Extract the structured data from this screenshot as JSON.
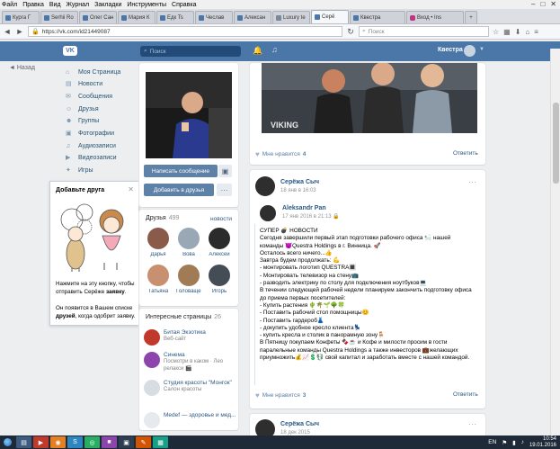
{
  "browser": {
    "menu": [
      "Файл",
      "Правка",
      "Вид",
      "Журнал",
      "Закладки",
      "Инструменты",
      "Справка"
    ],
    "tabs": [
      {
        "label": "Курга Г",
        "icon": "vk"
      },
      {
        "label": "Serhii Ro",
        "icon": "vk"
      },
      {
        "label": "Олег Сан",
        "icon": "vk"
      },
      {
        "label": "Мария К",
        "icon": "vk"
      },
      {
        "label": "Едк Ts",
        "icon": "vk"
      },
      {
        "label": "Чеслав",
        "icon": "vk"
      },
      {
        "label": "Алексан",
        "icon": "vk"
      },
      {
        "label": "Luxury te",
        "icon": "gen"
      },
      {
        "label": "Серё",
        "icon": "vk"
      },
      {
        "label": "Квестра",
        "icon": "vk"
      },
      {
        "label": "Вход • Ins",
        "icon": "ig"
      }
    ],
    "url": "https://vk.com/id21449087",
    "search_placeholder": "Поиск"
  },
  "vk_header": {
    "logo": "VK",
    "search_placeholder": "Поиск",
    "user_name": "Квестра"
  },
  "left_nav": {
    "back_label": "Назад",
    "items": [
      {
        "label": "Моя Страница",
        "icon": "home-icon",
        "glyph": "⌂"
      },
      {
        "label": "Новости",
        "icon": "news-icon",
        "glyph": "▤"
      },
      {
        "label": "Сообщения",
        "icon": "messages-icon",
        "glyph": "✉"
      },
      {
        "label": "Друзья",
        "icon": "friends-icon",
        "glyph": "☺"
      },
      {
        "label": "Группы",
        "icon": "groups-icon",
        "glyph": "☻"
      },
      {
        "label": "Фотографии",
        "icon": "photos-icon",
        "glyph": "▣"
      },
      {
        "label": "Аудиозаписи",
        "icon": "audio-icon",
        "glyph": "♫"
      },
      {
        "label": "Видеозаписи",
        "icon": "video-icon",
        "glyph": "▶"
      },
      {
        "label": "Игры",
        "icon": "games-icon",
        "glyph": "✦"
      }
    ]
  },
  "tooltip": {
    "title": "Добавьте друга",
    "p1_pre": "Нажмите на эту кнопку, чтобы отправить Серёже ",
    "p1_bold": "заявку",
    "p1_post": ".",
    "p2_pre": "Он появится в Вашем списке ",
    "p2_bold": "друзей",
    "p2_post": ", когда одобрит заявку."
  },
  "profile": {
    "send_message": "Написать сообщение",
    "add_friend": "Добавить в друзья",
    "more": "···"
  },
  "friends": {
    "title": "Друзья",
    "count": "499",
    "link": "новости",
    "items": [
      {
        "name": "Дарья",
        "color": "#8a5a4a"
      },
      {
        "name": "Вова",
        "color": "#9aa7b5"
      },
      {
        "name": "Алексей",
        "color": "#2b2b2b"
      },
      {
        "name": "Татьяна",
        "color": "#c88f70"
      },
      {
        "name": "Головаще...",
        "color": "#a07b55"
      },
      {
        "name": "Игорь",
        "color": "#444c55"
      }
    ]
  },
  "interesting": {
    "title": "Интересные страницы",
    "count": "26",
    "items": [
      {
        "name": "Битая Экзотика",
        "desc": "Веб-сайт",
        "color": "#c0392b"
      },
      {
        "name": "Синема",
        "desc": "Посмотри в каком · Лео релакси 🎬",
        "color": "#8e44ad"
      },
      {
        "name": "Студия красоты \"Монгок\"",
        "desc": "Салон красоты",
        "color": "#d8dde4"
      },
      {
        "name": "Medef — здоровье и мед...",
        "desc": "",
        "color": "#e6e9ed"
      }
    ]
  },
  "post1": {
    "likes_label": "Мне нравится",
    "likes": "4",
    "reply": "Ответить",
    "watermark": "VIKING"
  },
  "post2": {
    "author": "Серёжа Сыч",
    "date": "18 янв в 16:03",
    "repost_author": "Aleksandr Pan",
    "repost_date": "17 янв 2016 в 21:13 🔒",
    "text": [
      "СУПЕР 💣 НОВОСТИ",
      "Сегодня завершили первый этап подготовки рабочего офиса 🛀 нашей",
      "команды 😈Questra Holdings в г. Винница. 🚀",
      "Осталось всего ничего...👍",
      "Завтра будем продолжать: 💪",
      "- монтировать логотип QUESTRA🔳",
      "- Монтировать телевизор на стену📺",
      "- разводить электрику по столу для подключения ноутбуков💻",
      "В течении следующей рабочей недели планируем закончить подготовку офиса",
      "до приема первых посетителей:",
      "- Купить растения 🌵🌴🌱🌳🍀",
      "- Поставить рабочий стол помощницы😊",
      "- Поставить гардероб👗",
      "- докупить удобное кресло клиента💺",
      "- купить кресла и столик в панорамную зону🪑",
      "В Пятницу покупаем Конфеты 🍫☕ и Кофе и милости просим в гости",
      "паралельные команды Questra Holdings а также инвесторов 💼желающих",
      "приумножить💰📈💲💱 свой капитал и заработать вместе с нашей командой."
    ],
    "likes_label": "Мне нравится",
    "likes": "3",
    "reply": "Ответить"
  },
  "post3": {
    "author": "Серёжа Сыч",
    "date": "18 дек 2015"
  },
  "taskbar": {
    "lang": "EN",
    "time": "10:54",
    "date": "19.01.2016"
  }
}
